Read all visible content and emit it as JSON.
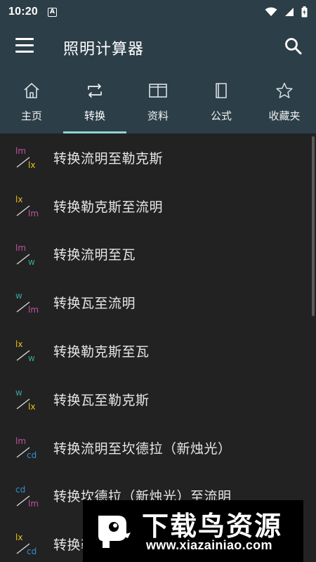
{
  "status_bar": {
    "time": "10:20",
    "notification_glyph": "A",
    "icons": [
      "wifi-icon",
      "signal-icon",
      "battery-icon"
    ]
  },
  "app_bar": {
    "title": "照明计算器",
    "menu_icon": "hamburger-menu-icon",
    "search_icon": "search-icon"
  },
  "tabs": [
    {
      "label": "主页",
      "icon": "home-icon",
      "active": false
    },
    {
      "label": "转换",
      "icon": "swap-icon",
      "active": true
    },
    {
      "label": "资料",
      "icon": "book-open-icon",
      "active": false
    },
    {
      "label": "公式",
      "icon": "book-icon",
      "active": false
    },
    {
      "label": "收藏夹",
      "icon": "star-icon",
      "active": false
    }
  ],
  "conversions": [
    {
      "top": "lm",
      "bottom": "lx",
      "label": "转换流明至勒克斯"
    },
    {
      "top": "lx",
      "bottom": "lm",
      "label": "转换勒克斯至流明"
    },
    {
      "top": "lm",
      "bottom": "w",
      "label": "转换流明至瓦"
    },
    {
      "top": "w",
      "bottom": "lm",
      "label": "转换瓦至流明"
    },
    {
      "top": "lx",
      "bottom": "w",
      "label": "转换勒克斯至瓦"
    },
    {
      "top": "w",
      "bottom": "lx",
      "label": "转换瓦至勒克斯"
    },
    {
      "top": "lm",
      "bottom": "cd",
      "label": "转换流明至坎德拉（新烛光）"
    },
    {
      "top": "cd",
      "bottom": "lm",
      "label": "转换坎德拉（新烛光）至流明"
    },
    {
      "top": "lx",
      "bottom": "cd",
      "label": "转换勒克斯至坎德拉（新烛光）"
    }
  ],
  "unit_colors": {
    "lm": "#c2529f",
    "lx": "#e8c21c",
    "w": "#3aa39a",
    "cd": "#2f8fd0",
    "slash": "#d8d8d8"
  },
  "theme": {
    "header_bg": "#2c3e47",
    "list_bg": "#222222",
    "tab_indicator": "#8fd3d2"
  },
  "watermark": {
    "brand": "下载鸟资源",
    "url": "www.xiazainiao.com"
  }
}
